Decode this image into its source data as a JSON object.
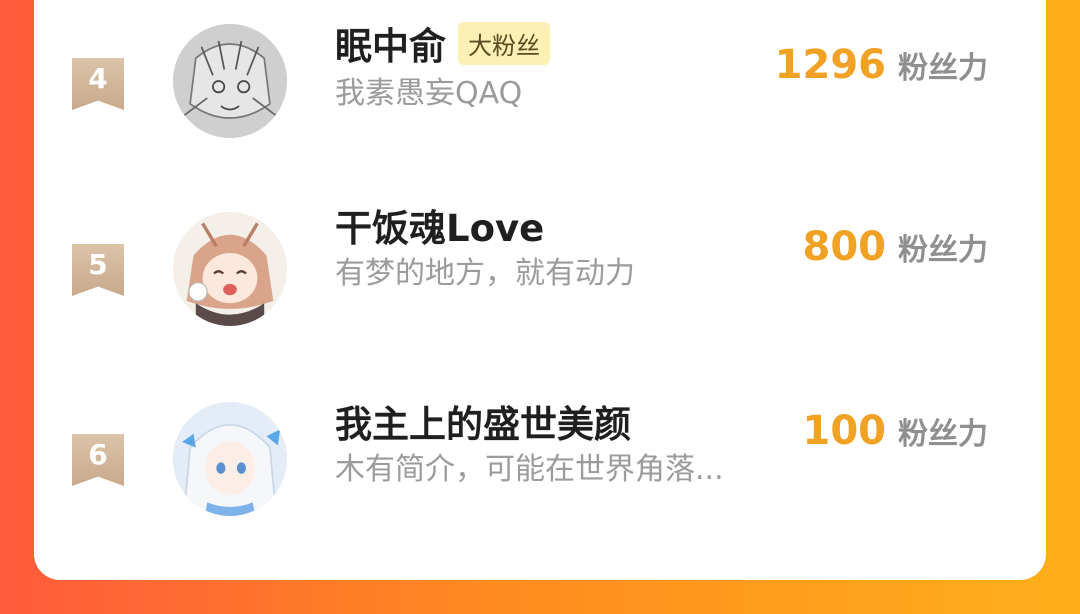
{
  "colors": {
    "background_gradient": [
      "#ff5a3c",
      "#ff8a1f",
      "#ffb01a"
    ],
    "card": "#ffffff",
    "score": "#f1a123",
    "badge_bg": "#fdf0b5",
    "name": "#1f1f1f",
    "bio": "#9b9b9b",
    "unit": "#8f8f8f"
  },
  "ranking": [
    {
      "rank": "4",
      "name": "眠中俞",
      "badge": "大粉丝",
      "bio": "我素愚妄QAQ",
      "score": "1296",
      "unit": "粉丝力",
      "avatar": "sketch-portrait"
    },
    {
      "rank": "5",
      "name": "干饭魂Love",
      "badge": "",
      "bio": "有梦的地方，就有动力",
      "score": "800",
      "unit": "粉丝力",
      "avatar": "anime-girl-pink"
    },
    {
      "rank": "6",
      "name": "我主上的盛世美颜",
      "badge": "",
      "bio": "木有简介，可能在世界角落...",
      "score": "100",
      "unit": "粉丝力",
      "avatar": "anime-white-hair-butterflies"
    }
  ]
}
